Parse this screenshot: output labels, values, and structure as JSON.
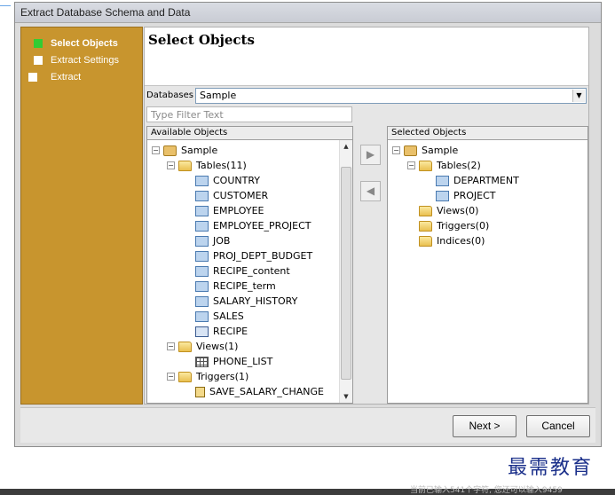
{
  "window": {
    "title": "Extract Database Schema and Data"
  },
  "steps": [
    {
      "label": "Select Objects",
      "active": true
    },
    {
      "label": "Extract Settings",
      "active": false
    },
    {
      "label": "Extract",
      "active": false
    }
  ],
  "page": {
    "title": "Select Objects"
  },
  "databases": {
    "label": "Databases",
    "selected": "Sample"
  },
  "filter": {
    "placeholder": "Type Filter Text"
  },
  "available": {
    "header": "Available Objects",
    "db": "Sample",
    "tables_folder": "Tables(11)",
    "tables": [
      "COUNTRY",
      "CUSTOMER",
      "EMPLOYEE",
      "EMPLOYEE_PROJECT",
      "JOB",
      "PROJ_DEPT_BUDGET",
      "RECIPE_content",
      "RECIPE_term",
      "SALARY_HISTORY",
      "SALES",
      "RECIPE"
    ],
    "views_folder": "Views(1)",
    "views": [
      "PHONE_LIST"
    ],
    "triggers_folder": "Triggers(1)",
    "triggers": [
      "SAVE_SALARY_CHANGE"
    ]
  },
  "selected": {
    "header": "Selected Objects",
    "db": "Sample",
    "tables_folder": "Tables(2)",
    "tables": [
      "DEPARTMENT",
      "PROJECT"
    ],
    "views_folder": "Views(0)",
    "triggers_folder": "Triggers(0)",
    "indices_folder": "Indices(0)"
  },
  "buttons": {
    "next": "Next >",
    "cancel": "Cancel"
  },
  "watermark": "最需教育",
  "strip_text": "当前已输入541个字符, 您还可以输入9459",
  "colors": {
    "steps_bg": "#c8952e",
    "active_step_mark": "#33cc33",
    "watermark": "#1a2f8a"
  }
}
